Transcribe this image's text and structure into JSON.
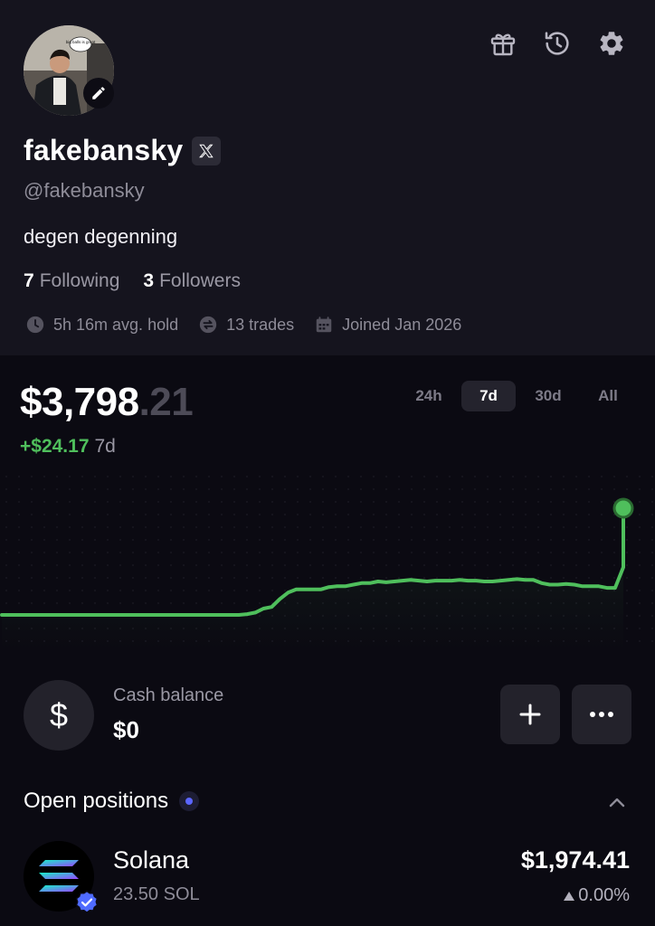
{
  "profile": {
    "name": "fakebansky",
    "handle": "@fakebansky",
    "bio": "degen degenning",
    "following_count": "7",
    "following_label": "Following",
    "followers_count": "3",
    "followers_label": "Followers",
    "avatar_text": "big balls is great",
    "stats": {
      "avg_hold": "5h 16m avg. hold",
      "trades": "13 trades",
      "joined": "Joined Jan 2026"
    }
  },
  "icons": [
    "gift-icon",
    "history-icon",
    "settings-gear-icon",
    "pencil-icon",
    "x-logo-icon",
    "clock-icon",
    "swap-icon",
    "calendar-icon",
    "dollar-icon",
    "plus-icon",
    "more-dots-icon",
    "chevron-up-icon",
    "solana-logo-icon",
    "verified-badge-icon",
    "triangle-up-icon"
  ],
  "portfolio": {
    "value_main": "$3,798",
    "value_cents": ".21",
    "change": "+$24.17",
    "period": "7d",
    "ranges": [
      "24h",
      "7d",
      "30d",
      "All"
    ],
    "selected_range": "7d"
  },
  "chart_data": {
    "type": "line",
    "title": "",
    "xlabel": "",
    "ylabel": "",
    "grid": true,
    "series": [
      {
        "values": [
          3640,
          3640,
          3640,
          3640,
          3640,
          3640,
          3640,
          3640,
          3640,
          3640,
          3640,
          3640,
          3640,
          3640,
          3640,
          3640,
          3640,
          3640,
          3640,
          3640,
          3640,
          3640,
          3640,
          3640,
          3640,
          3640,
          3640,
          3640,
          3640,
          3640,
          3641,
          3643,
          3648,
          3650,
          3660,
          3668,
          3672,
          3672,
          3672,
          3672,
          3675,
          3676,
          3676,
          3678,
          3680,
          3680,
          3682,
          3681,
          3682,
          3683,
          3684,
          3683,
          3682,
          3683,
          3683,
          3683,
          3684,
          3683,
          3683,
          3682,
          3682,
          3683,
          3684,
          3685,
          3684,
          3684,
          3680,
          3678,
          3678,
          3679,
          3678,
          3676,
          3676,
          3676,
          3674,
          3674,
          3700,
          3774
        ]
      }
    ],
    "line_color": "#4fbf5c"
  },
  "cash": {
    "label": "Cash balance",
    "value": "$0",
    "symbol": "$"
  },
  "positions": {
    "title": "Open positions",
    "items": [
      {
        "name": "Solana",
        "amount": "23.50 SOL",
        "value": "$1,974.41",
        "change": "0.00%"
      }
    ]
  }
}
